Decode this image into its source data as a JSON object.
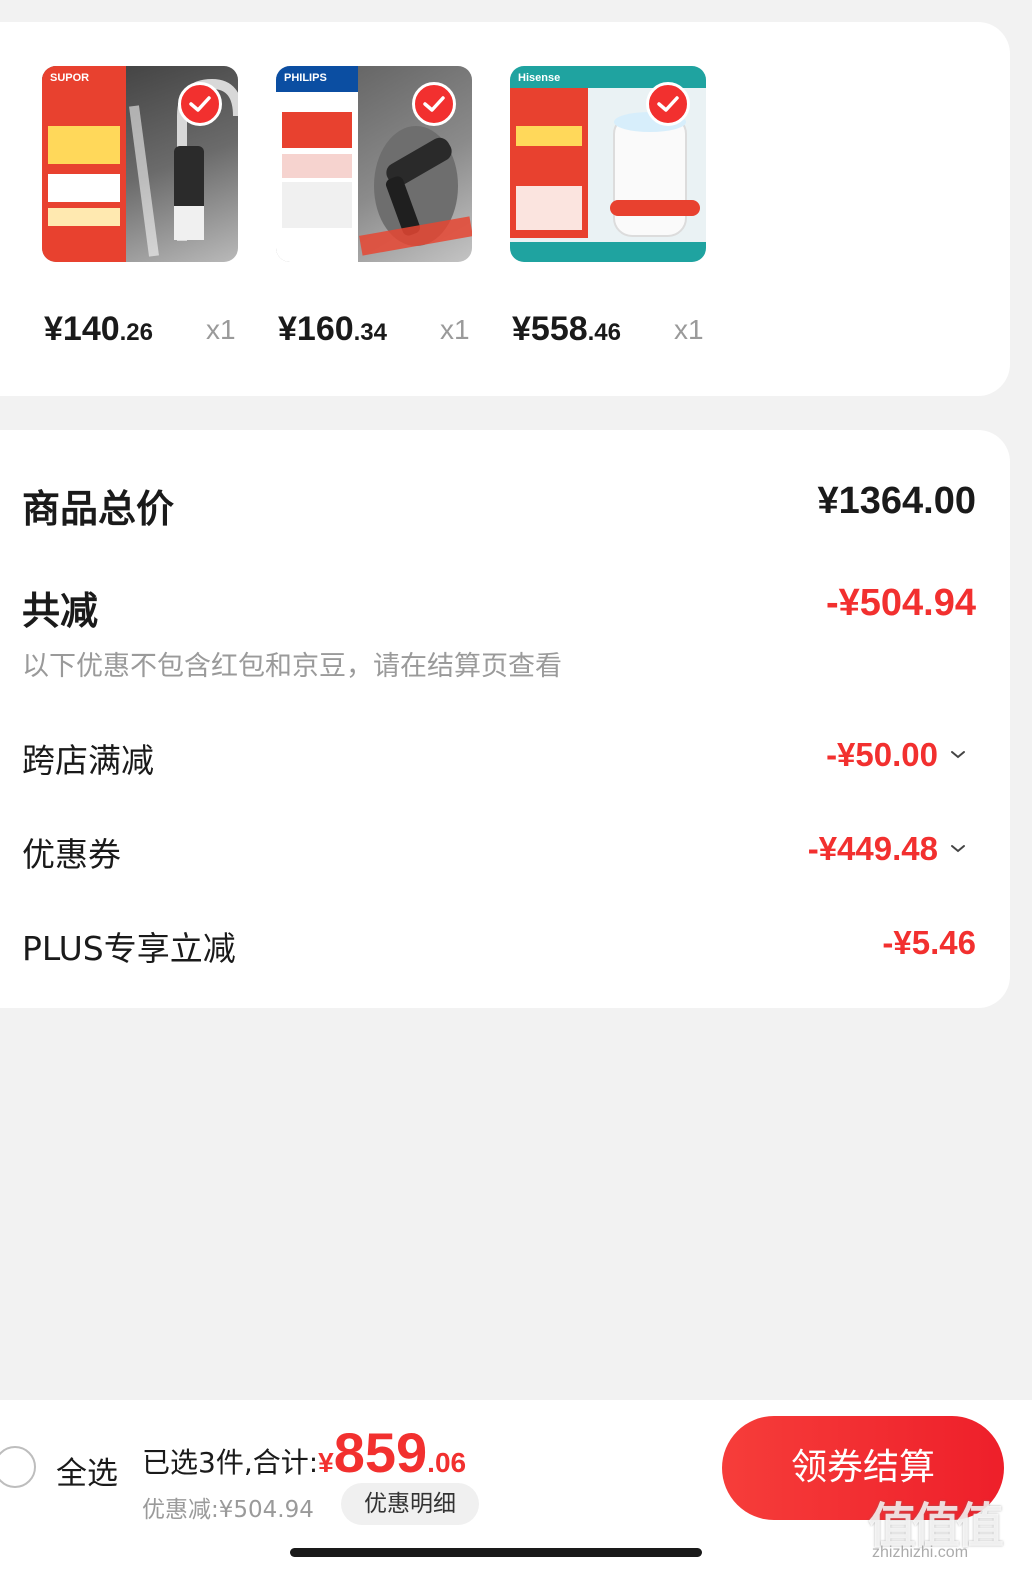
{
  "products": [
    {
      "brand": "SUPOR",
      "price_int": "¥140",
      "price_dec": ".26",
      "qty": "x1",
      "selected": true
    },
    {
      "brand": "PHILIPS",
      "price_int": "¥160",
      "price_dec": ".34",
      "qty": "x1",
      "selected": true
    },
    {
      "brand": "Hisense",
      "price_int": "¥558",
      "price_dec": ".46",
      "qty": "x1",
      "selected": true
    }
  ],
  "summary": {
    "total_label": "商品总价",
    "total_value": "¥1364.00",
    "reduce_label": "共减",
    "reduce_value": "-¥504.94",
    "note": "以下优惠不包含红包和京豆，请在结算页查看",
    "items": [
      {
        "label": "跨店满减",
        "value": "-¥50.00",
        "expandable": true
      },
      {
        "label": "优惠券",
        "value": "-¥449.48",
        "expandable": true
      },
      {
        "label": "PLUS专享立减",
        "value": "-¥5.46",
        "expandable": false
      }
    ]
  },
  "bottom": {
    "select_all": "全选",
    "selected_text": "已选3件,合计:",
    "currency": "¥",
    "total_int": "859",
    "total_dec": ".06",
    "discount_text": "优惠减:¥504.94",
    "details_button": "优惠明细",
    "checkout_button": "领券结算"
  },
  "watermark": {
    "logo": "值值值",
    "site": "zhizhizhi.com"
  },
  "colors": {
    "accent": "#f2302f",
    "muted": "#9a9a9a"
  }
}
